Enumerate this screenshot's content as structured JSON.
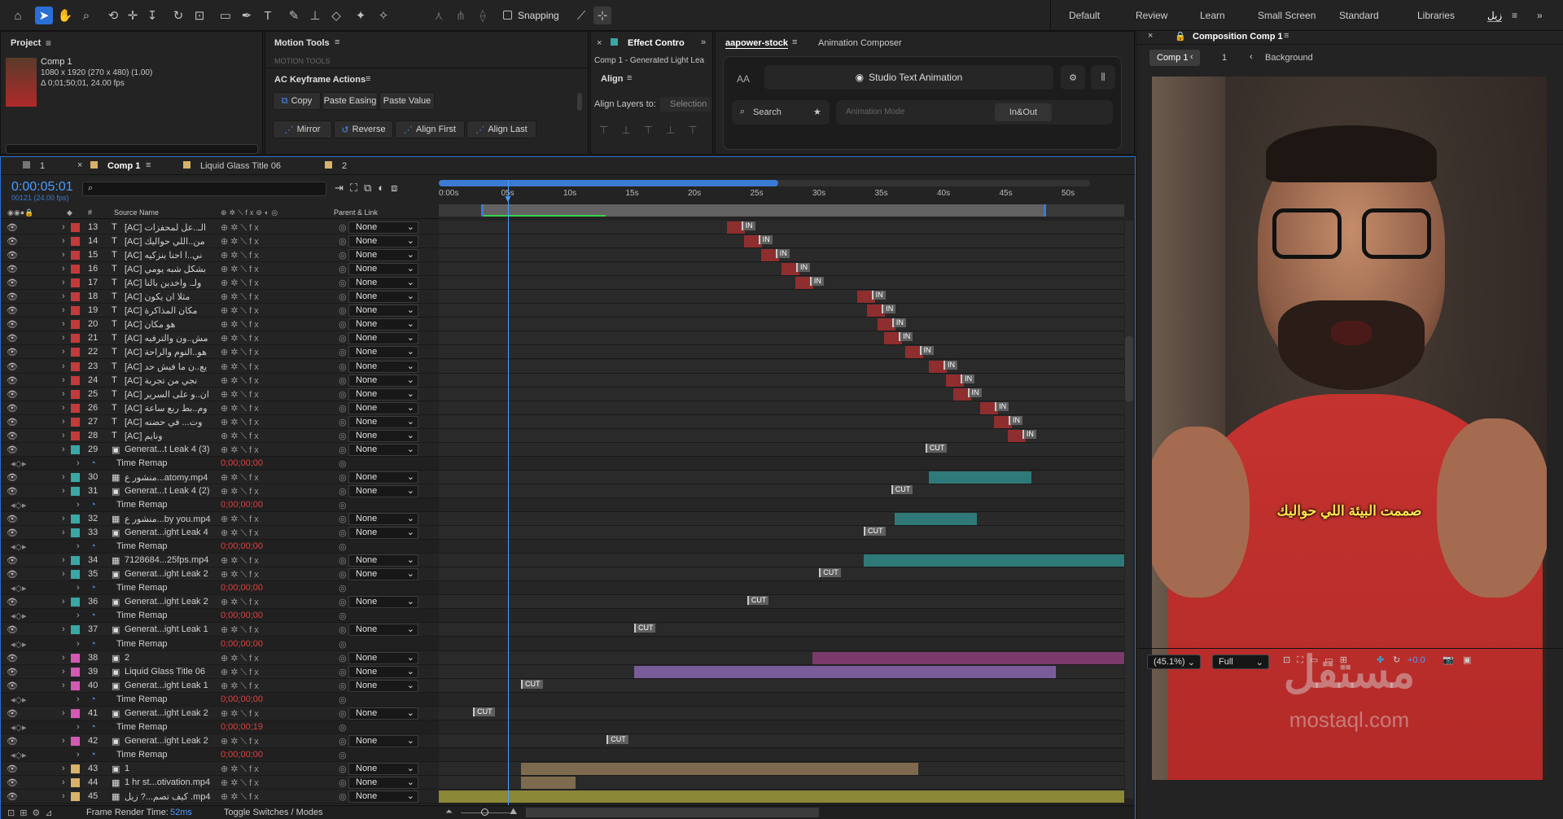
{
  "toolbar": {
    "snapping_label": "Snapping",
    "workspaces": [
      "Default",
      "Review",
      "Learn",
      "Small Screen",
      "Standard",
      "Libraries",
      "زيل"
    ]
  },
  "project": {
    "tab": "Project",
    "comp_name": "Comp 1",
    "comp_info": "1080 x 1920 (270 x 480) (1.00)",
    "comp_duration": "Δ 0;01;50;01, 24.00 fps"
  },
  "motion_tools": {
    "tab": "Motion Tools",
    "sub": "MOTION TOOLS"
  },
  "keyframe_actions": {
    "tab": "AC Keyframe Actions",
    "buttons": [
      "Copy",
      "Paste Easing",
      "Paste Value"
    ],
    "buttons2": [
      "Mirror",
      "Reverse",
      "Align First",
      "Align Last"
    ]
  },
  "effect_controls": {
    "tab": "Effect Contro",
    "subtitle": "Comp 1 - Generated Light Lea",
    "align_tab": "Align",
    "align_to_label": "Align Layers to:",
    "align_to_value": "Selection"
  },
  "aapower": {
    "tab": "aapower-stock",
    "tab2": "Animation Composer",
    "title": "Studio Text Animation",
    "search": "Search",
    "mode_placeholder": "Animation Mode",
    "mode_button": "In&Out",
    "aa": "AA"
  },
  "composition": {
    "tab": "Composition Comp 1",
    "crumb1": "Comp 1",
    "crumb2": "1",
    "crumb3": "Background",
    "subtitle_ar": "صممت البيئة اللي حواليك",
    "zoom": "(45.1%)",
    "quality": "Full",
    "exposure": "+0.0",
    "watermark": "مستقل",
    "watermark_url": "mostaql.com"
  },
  "timeline": {
    "tabs": [
      "1",
      "Comp 1",
      "Liquid Glass Title 06",
      "2"
    ],
    "timecode": "0:00:05:01",
    "frames": "00121 (24.00 fps)",
    "col_source": "Source Name",
    "col_parent": "Parent & Link",
    "ruler": [
      "0:00s",
      "05s",
      "10s",
      "15s",
      "20s",
      "25s",
      "30s",
      "35s",
      "40s",
      "45s",
      "50s"
    ],
    "render_time_label": "Frame Render Time:",
    "render_time": "52ms",
    "toggle_label": "Toggle Switches / Modes",
    "rows": [
      {
        "n": "13",
        "name": "[AC] الـ..عل لمحفزات",
        "c": "#c23b3b",
        "t": "T",
        "p": "None",
        "kind": "in",
        "x": 0.42
      },
      {
        "n": "14",
        "name": "[AC] من..اللي حواليك",
        "c": "#c23b3b",
        "t": "T",
        "p": "None",
        "kind": "in",
        "x": 0.445
      },
      {
        "n": "15",
        "name": "[AC] ني..ا احنا بنزكيه",
        "c": "#c23b3b",
        "t": "T",
        "p": "None",
        "kind": "in",
        "x": 0.47
      },
      {
        "n": "16",
        "name": "[AC] بشكل شبه يومي",
        "c": "#c23b3b",
        "t": "T",
        "p": "None",
        "kind": "in",
        "x": 0.5
      },
      {
        "n": "17",
        "name": "[AC] ولـ. واخدين بالنا",
        "c": "#c23b3b",
        "t": "T",
        "p": "None",
        "kind": "in",
        "x": 0.52
      },
      {
        "n": "18",
        "name": "[AC] مثلا ان يكون",
        "c": "#c23b3b",
        "t": "T",
        "p": "None",
        "kind": "in",
        "x": 0.61
      },
      {
        "n": "19",
        "name": "[AC] مكان المذاكرة",
        "c": "#c23b3b",
        "t": "T",
        "p": "None",
        "kind": "in",
        "x": 0.625
      },
      {
        "n": "20",
        "name": "[AC] هو مكان",
        "c": "#c23b3b",
        "t": "T",
        "p": "None",
        "kind": "in",
        "x": 0.64
      },
      {
        "n": "21",
        "name": "[AC] مش..ون والترفيه",
        "c": "#c23b3b",
        "t": "T",
        "p": "None",
        "kind": "in",
        "x": 0.65
      },
      {
        "n": "22",
        "name": "[AC] هو..النوم والراحة",
        "c": "#c23b3b",
        "t": "T",
        "p": "None",
        "kind": "in",
        "x": 0.68
      },
      {
        "n": "23",
        "name": "[AC] يع..ن ما فيش حد",
        "c": "#c23b3b",
        "t": "T",
        "p": "None",
        "kind": "in",
        "x": 0.715
      },
      {
        "n": "24",
        "name": "[AC] نجي من تجربة",
        "c": "#c23b3b",
        "t": "T",
        "p": "None",
        "kind": "in",
        "x": 0.74
      },
      {
        "n": "25",
        "name": "[AC] ان..و على السرير",
        "c": "#c23b3b",
        "t": "T",
        "p": "None",
        "kind": "in",
        "x": 0.75
      },
      {
        "n": "26",
        "name": "[AC] وم..بط ربع ساعة",
        "c": "#c23b3b",
        "t": "T",
        "p": "None",
        "kind": "in",
        "x": 0.79
      },
      {
        "n": "27",
        "name": "[AC] وت... في حضنه",
        "c": "#c23b3b",
        "t": "T",
        "p": "None",
        "kind": "in",
        "x": 0.81
      },
      {
        "n": "28",
        "name": "[AC] ونايم",
        "c": "#c23b3b",
        "t": "T",
        "p": "None",
        "kind": "in",
        "x": 0.83
      },
      {
        "n": "29",
        "name": "Generat...t Leak 4 (3)",
        "c": "#3aa7a5",
        "t": "c",
        "p": "None",
        "kind": "cut",
        "x": 0.71
      },
      {
        "n": "",
        "name": "Time Remap",
        "sub": true,
        "tr": "0;00;00;00"
      },
      {
        "n": "30",
        "name": "منشور ع...atomy.mp4",
        "c": "#3aa7a5",
        "t": "v",
        "p": "None",
        "kind": "teal",
        "x": 0.715,
        "w": 0.15
      },
      {
        "n": "31",
        "name": "Generat...t Leak 4 (2)",
        "c": "#3aa7a5",
        "t": "c",
        "p": "None",
        "kind": "cut",
        "x": 0.66
      },
      {
        "n": "",
        "name": "Time Remap",
        "sub": true,
        "tr": "0;00;00;00"
      },
      {
        "n": "32",
        "name": "منشور ع...by you.mp4",
        "c": "#3aa7a5",
        "t": "v",
        "p": "None",
        "kind": "teal",
        "x": 0.665,
        "w": 0.12
      },
      {
        "n": "33",
        "name": "Generat...ight Leak 4",
        "c": "#3aa7a5",
        "t": "c",
        "p": "None",
        "kind": "cut",
        "x": 0.62
      },
      {
        "n": "",
        "name": "Time Remap",
        "sub": true,
        "tr": "0;00;00;00"
      },
      {
        "n": "34",
        "name": "7128684...25fps.mp4",
        "c": "#3aa7a5",
        "t": "v",
        "p": "None",
        "kind": "teal",
        "x": 0.62,
        "w": 0.38
      },
      {
        "n": "35",
        "name": "Generat...ight Leak 2",
        "c": "#3aa7a5",
        "t": "c",
        "p": "None",
        "kind": "cut",
        "x": 0.555
      },
      {
        "n": "",
        "name": "Time Remap",
        "sub": true,
        "tr": "0;00;00;00"
      },
      {
        "n": "36",
        "name": "Generat...ight Leak 2",
        "c": "#3aa7a5",
        "t": "c",
        "p": "None",
        "kind": "cut",
        "x": 0.45
      },
      {
        "n": "",
        "name": "Time Remap",
        "sub": true,
        "tr": "0;00;00;00"
      },
      {
        "n": "37",
        "name": "Generat...ight Leak 1",
        "c": "#3aa7a5",
        "t": "c",
        "p": "None",
        "kind": "cut",
        "x": 0.285
      },
      {
        "n": "",
        "name": "Time Remap",
        "sub": true,
        "tr": "0;00;00;00"
      },
      {
        "n": "38",
        "name": "2",
        "c": "#d35ab3",
        "t": "c",
        "p": "None",
        "kind": "pink",
        "x": 0.545,
        "w": 0.455
      },
      {
        "n": "39",
        "name": "Liquid Glass Title 06",
        "c": "#d35ab3",
        "t": "c",
        "p": "None",
        "kind": "purple",
        "x": 0.285,
        "w": 0.615
      },
      {
        "n": "40",
        "name": "Generat...ight Leak 1",
        "c": "#d35ab3",
        "t": "c",
        "p": "None",
        "kind": "cut",
        "x": 0.12
      },
      {
        "n": "",
        "name": "Time Remap",
        "sub": true,
        "tr": "0;00;00;00"
      },
      {
        "n": "41",
        "name": "Generat...ight Leak 2",
        "c": "#d35ab3",
        "t": "c",
        "p": "None",
        "kind": "cut",
        "x": 0.05
      },
      {
        "n": "",
        "name": "Time Remap",
        "sub": true,
        "tr": "0;00;00;19"
      },
      {
        "n": "42",
        "name": "Generat...ight Leak 2",
        "c": "#d35ab3",
        "t": "c",
        "p": "None",
        "kind": "cut",
        "x": 0.245
      },
      {
        "n": "",
        "name": "Time Remap",
        "sub": true,
        "tr": "0;00;00;00"
      },
      {
        "n": "43",
        "name": "1",
        "c": "#d8b26a",
        "t": "c",
        "p": "None",
        "kind": "tan",
        "x": 0.12,
        "w": 0.58
      },
      {
        "n": "44",
        "name": "1 hr st...otivation.mp4",
        "c": "#d8b26a",
        "t": "v",
        "p": "None",
        "kind": "tan",
        "x": 0.12,
        "w": 0.08
      },
      {
        "n": "45",
        "name": "كيف تصم...? زيل .mp4",
        "c": "#d8b26a",
        "t": "v",
        "p": "None",
        "kind": "olive",
        "x": 0.0,
        "w": 1.0
      }
    ]
  }
}
